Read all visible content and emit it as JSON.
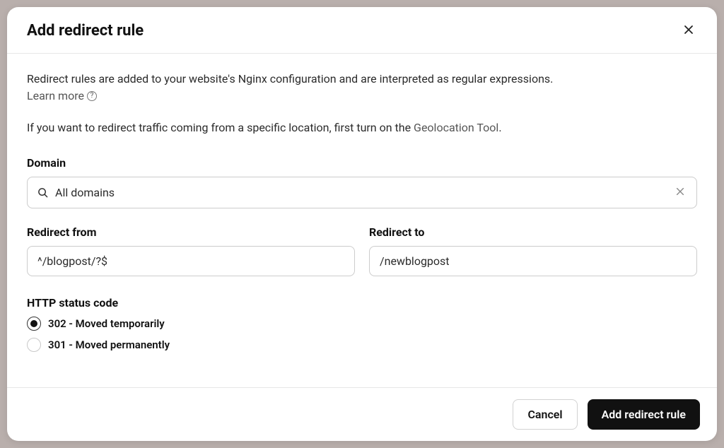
{
  "modal": {
    "title": "Add redirect rule",
    "description": "Redirect rules are added to your website's Nginx configuration and are interpreted as regular expressions.",
    "learn_more": "Learn more",
    "geo_text_prefix": "If you want to redirect traffic coming from a specific location, first turn on the ",
    "geo_link": "Geolocation Tool",
    "geo_text_suffix": "."
  },
  "domain": {
    "label": "Domain",
    "value": "All domains"
  },
  "redirect_from": {
    "label": "Redirect from",
    "value": "^/blogpost/?$"
  },
  "redirect_to": {
    "label": "Redirect to",
    "value": "/newblogpost"
  },
  "status": {
    "label": "HTTP status code",
    "options": [
      {
        "label": "302 - Moved temporarily",
        "selected": true
      },
      {
        "label": "301 - Moved permanently",
        "selected": false
      }
    ]
  },
  "footer": {
    "cancel": "Cancel",
    "submit": "Add redirect rule"
  }
}
